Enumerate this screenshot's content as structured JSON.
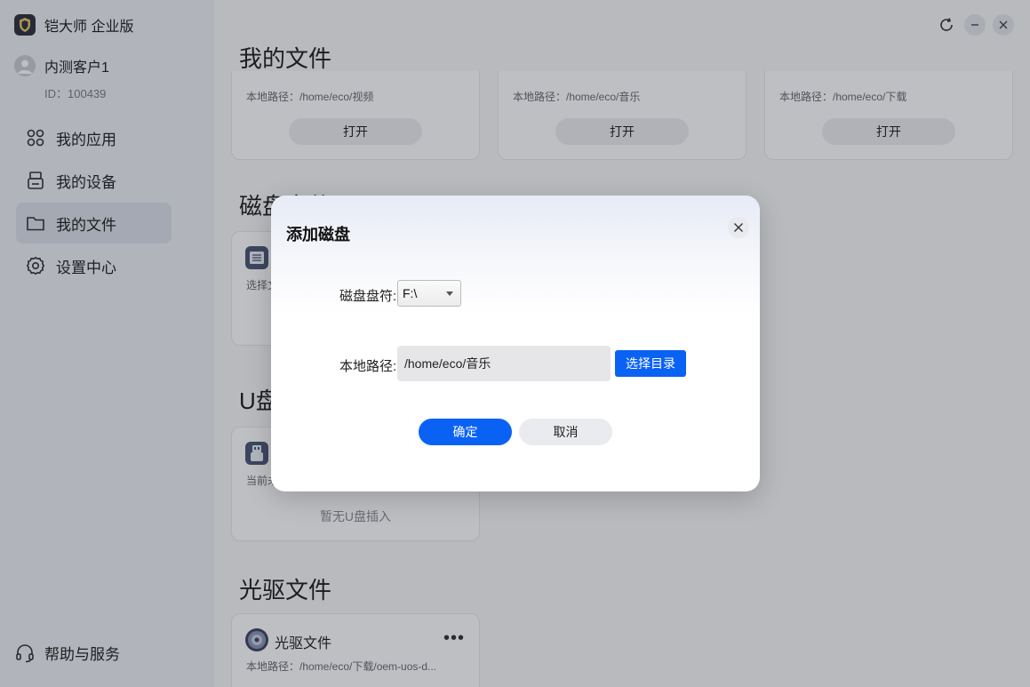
{
  "app": {
    "title": "铠大师 企业版"
  },
  "user": {
    "name": "内测客户1",
    "id": "ID：100439"
  },
  "sidebar": {
    "items": [
      {
        "label": "我的应用",
        "icon": "apps-icon"
      },
      {
        "label": "我的设备",
        "icon": "device-icon"
      },
      {
        "label": "我的文件",
        "icon": "folder-icon",
        "active": true
      },
      {
        "label": "设置中心",
        "icon": "gear-icon"
      }
    ],
    "help": "帮助与服务"
  },
  "main": {
    "title": "我的文件",
    "top_cards": [
      {
        "path": "本地路径：/home/eco/视频",
        "button": "打开"
      },
      {
        "path": "本地路径：/home/eco/音乐",
        "button": "打开"
      },
      {
        "path": "本地路径：/home/eco/下载",
        "button": "打开"
      }
    ],
    "disk_section": {
      "title": "磁盘文件",
      "card_text": "选择文"
    },
    "usb_section": {
      "title": "U盘文件",
      "card_text": "当前未",
      "empty": "暂无U盘插入"
    },
    "optical_section": {
      "title": "光驱文件",
      "card_name": "光驱文件",
      "more": "•••",
      "path": "本地路径：/home/eco/下载/oem-uos-d..."
    }
  },
  "dialog": {
    "title": "添加磁盘",
    "drive_label": "磁盘盘符:",
    "drive_value": "F:\\",
    "path_label": "本地路径:",
    "path_value": "/home/eco/音乐",
    "choose_button": "选择目录",
    "ok_button": "确定",
    "cancel_button": "取消"
  },
  "colors": {
    "accent": "#0a62f5",
    "sidebar_bg": "#eef0f4",
    "overlay": "rgba(20,24,36,0.28)"
  }
}
